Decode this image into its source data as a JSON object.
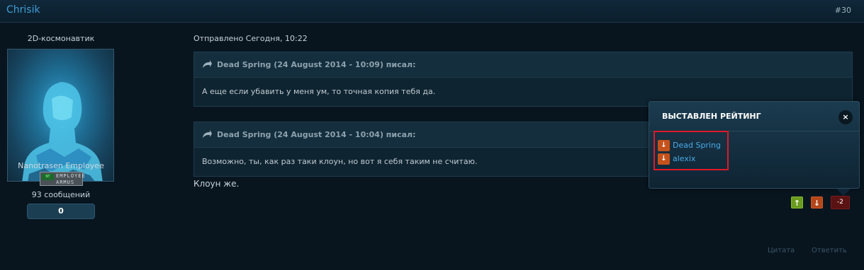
{
  "post": {
    "author": "Chrisik",
    "number": "#30"
  },
  "profile": {
    "title": "2D-космонавтик",
    "group": "Nanotrasen Employee",
    "badge_lines": [
      "EMPLOYEE",
      "ARMUS"
    ],
    "badge_logo": "NT",
    "posts_count": "93 сообщений",
    "reputation": "0"
  },
  "content": {
    "sent": "Отправлено Сегодня, 10:22",
    "quotes": [
      {
        "header": "Dead Spring (24 August 2014 - 10:09) писал:",
        "text": "А еще если убавить у меня ум, то точная копия тебя да."
      },
      {
        "header": "Dead Spring (24 August 2014 - 10:04) писал:",
        "text": "Возможно, ты, как раз таки клоун, но вот я себя таким не считаю."
      }
    ],
    "reply": "Клоун же."
  },
  "rating": {
    "up_icon": "arrow-up-icon",
    "down_icon": "arrow-down-icon",
    "score": "-2"
  },
  "actions": {
    "quote": "Цитата",
    "reply": "Ответить"
  },
  "popup": {
    "title": "ВЫСТАВЛЕН РЕЙТИНГ",
    "close": "×",
    "raters": [
      {
        "name": "Dead Spring",
        "vote": "down"
      },
      {
        "name": "alexix",
        "vote": "down"
      }
    ]
  },
  "colors": {
    "link": "#3f9ed6",
    "positive": "#6b9b1e",
    "negative": "#b4461a",
    "highlight": "#e0192a"
  }
}
